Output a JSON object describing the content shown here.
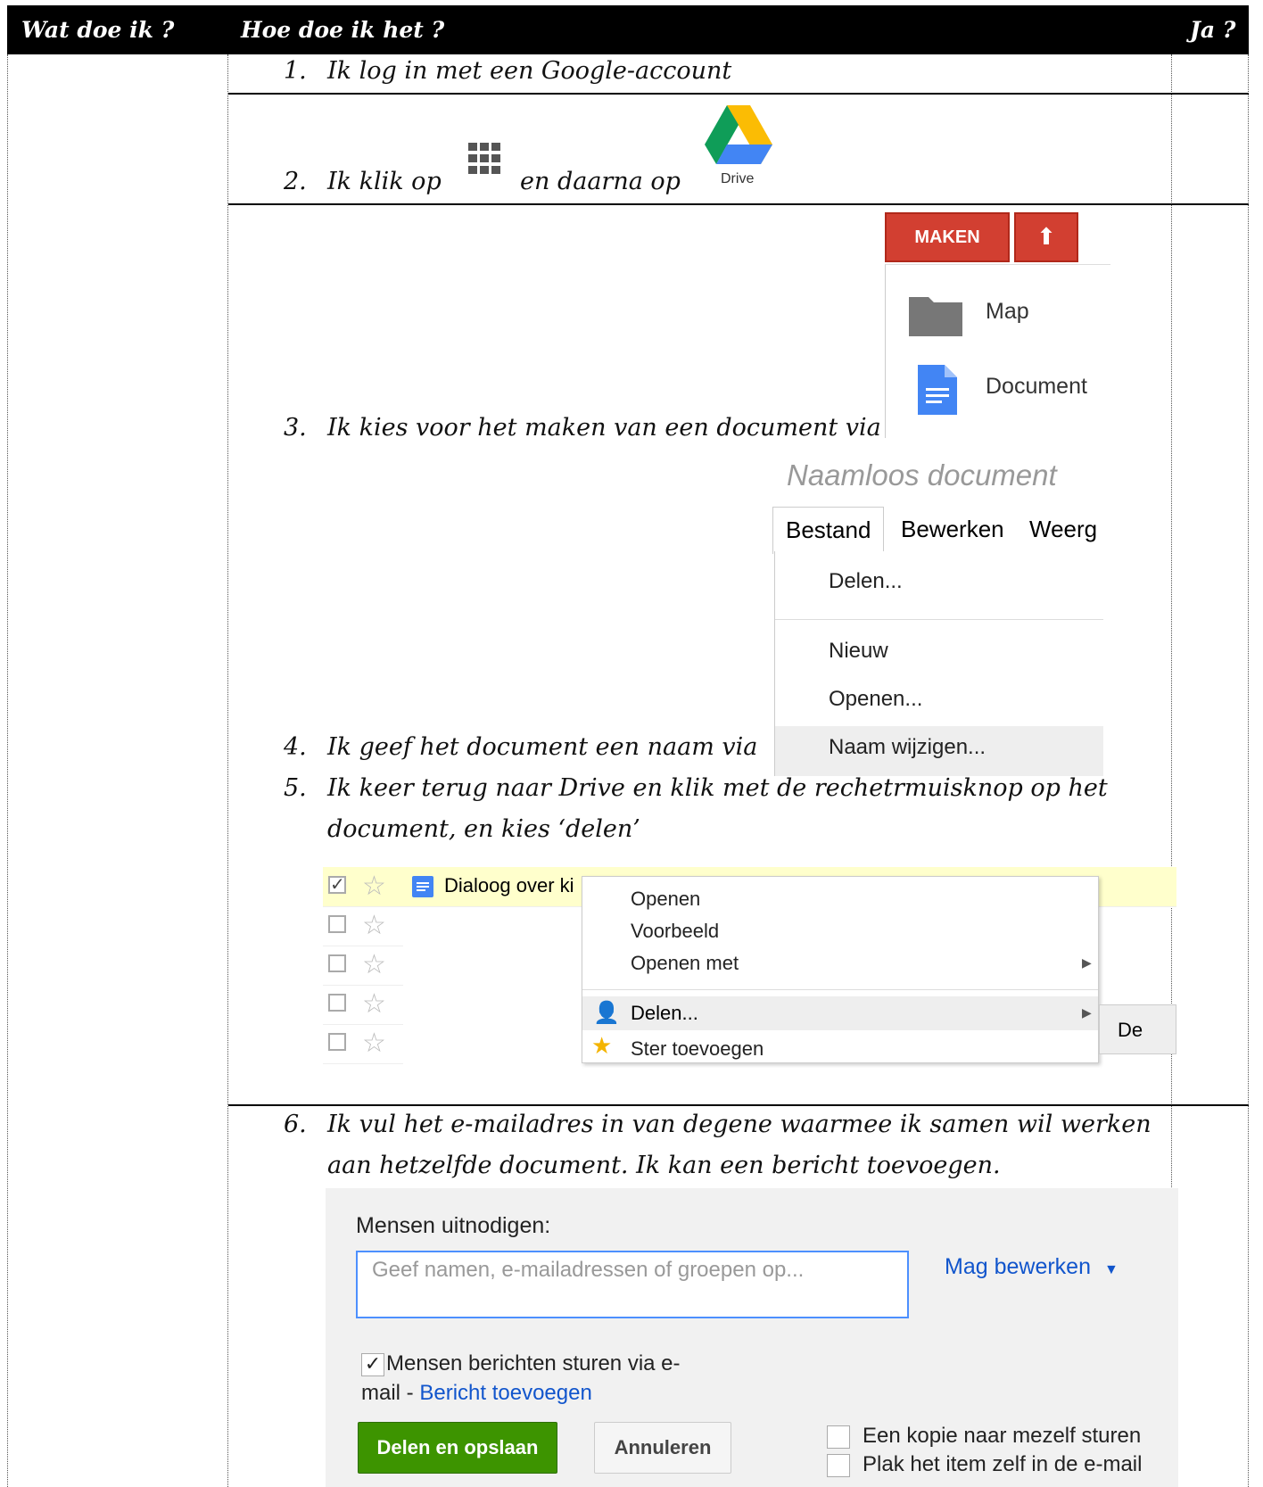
{
  "header": {
    "col1": "Wat doe ik ?",
    "col2": "Hoe doe ik het ?",
    "col3": "Ja ?"
  },
  "steps": {
    "s1": {
      "num": "1.",
      "text": "Ik log in met een Google-account"
    },
    "s2": {
      "num": "2.",
      "text_a": "Ik klik op",
      "text_b": "en daarna op",
      "drive_label": "Drive",
      "apps_icon": "apps-grid-icon",
      "drive_icon": "google-drive-icon"
    },
    "s3": {
      "num": "3.",
      "text": "Ik kies voor het maken van een document via"
    },
    "s4": {
      "num": "4.",
      "text": "Ik geef het document een naam via"
    },
    "s5": {
      "num": "5.",
      "line1": "Ik keer terug naar Drive en klik met de rechetrmuisknop op het",
      "line2": "document, en kies ‘delen’"
    },
    "s6": {
      "num": "6.",
      "line1": "Ik vul het e-mailadres in van degene waarmee ik samen wil werken",
      "line2": "aan hetzelfde document. Ik kan een bericht toevoegen."
    }
  },
  "maken": {
    "button": "MAKEN",
    "upload_icon": "upload-arrow-icon",
    "items": [
      {
        "label": "Map",
        "icon": "folder-icon"
      },
      {
        "label": "Document",
        "icon": "doc-icon"
      }
    ]
  },
  "docmenu": {
    "title": "Naamloos document",
    "menus": [
      "Bestand",
      "Bewerken",
      "Weerg"
    ],
    "items": [
      "Delen...",
      "Nieuw",
      "Openen...",
      "Naam wijzigen..."
    ]
  },
  "drivelist": {
    "file_name": "Dialoog over ki",
    "context": [
      "Openen",
      "Voorbeeld",
      "Openen met",
      "Delen...",
      "Ster toevoegen"
    ],
    "submenu": "De"
  },
  "share": {
    "invite_label": "Mensen uitnodigen:",
    "placeholder": "Geef namen, e-mailadressen of groepen op...",
    "permission": "Mag bewerken",
    "notify_a": "Mensen berichten sturen via e-",
    "notify_b": "mail - ",
    "add_message": "Bericht toevoegen",
    "share_btn": "Delen en opslaan",
    "cancel_btn": "Annuleren",
    "opt1": "Een kopie naar mezelf sturen",
    "opt2": "Plak het item zelf in de e-mail"
  },
  "colors": {
    "maken_red": "#d23f31",
    "share_green": "#3d9400",
    "link_blue": "#1155cc"
  }
}
